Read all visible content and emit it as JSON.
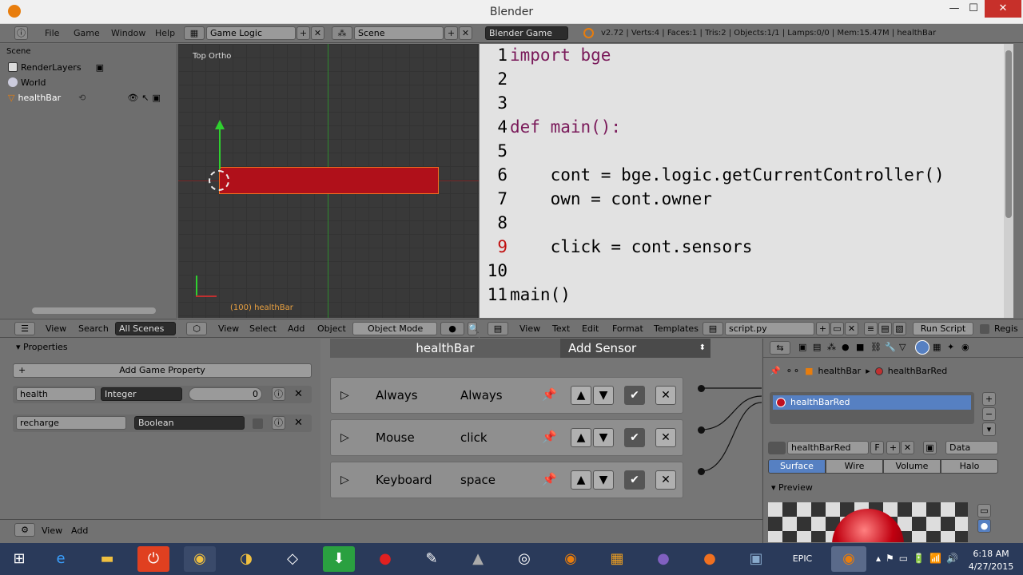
{
  "window": {
    "title": "Blender",
    "minimize": "—",
    "maximize": "☐",
    "close": "✕"
  },
  "menu": {
    "file": "File",
    "game": "Game",
    "window": "Window",
    "help": "Help"
  },
  "screen_layout": "Game Logic",
  "scene_name": "Scene",
  "engine": "Blender Game",
  "stats": "v2.72 | Verts:4 | Faces:1 | Tris:2 | Objects:1/1 | Lamps:0/0 | Mem:15.47M | healthBar",
  "outliner": {
    "header": "Scene",
    "items": [
      "RenderLayers",
      "World",
      "healthBar"
    ]
  },
  "viewport": {
    "label": "Top Ortho",
    "object_label": "(100) healthBar",
    "bar_color": "#b0101a"
  },
  "code": {
    "lines": [
      {
        "n": "1",
        "t": "import bge"
      },
      {
        "n": "2",
        "t": ""
      },
      {
        "n": "3",
        "t": ""
      },
      {
        "n": "4",
        "t": "def main():"
      },
      {
        "n": "5",
        "t": ""
      },
      {
        "n": "6",
        "t": "    cont = bge.logic.getCurrentController()"
      },
      {
        "n": "7",
        "t": "    own = cont.owner"
      },
      {
        "n": "8",
        "t": ""
      },
      {
        "n": "9",
        "t": "    click = cont.sensors"
      },
      {
        "n": "10",
        "t": ""
      },
      {
        "n": "11",
        "t": "main()"
      }
    ]
  },
  "outliner_header": {
    "view": "View",
    "search": "Search",
    "filter": "All Scenes"
  },
  "view3d_header": {
    "view": "View",
    "select": "Select",
    "add": "Add",
    "object": "Object",
    "mode": "Object Mode"
  },
  "text_header": {
    "view": "View",
    "text": "Text",
    "edit": "Edit",
    "format": "Format",
    "templates": "Templates",
    "filename": "script.py",
    "run": "Run Script",
    "register": "Regis"
  },
  "properties": {
    "title": "Properties",
    "add": "Add Game Property",
    "rows": [
      {
        "name": "health",
        "type": "Integer",
        "value": "0"
      },
      {
        "name": "recharge",
        "type": "Boolean",
        "value": ""
      }
    ]
  },
  "logic": {
    "object": "healthBar",
    "add_sensor": "Add Sensor",
    "sensors": [
      {
        "type": "Always",
        "name": "Always"
      },
      {
        "type": "Mouse",
        "name": "click"
      },
      {
        "type": "Keyboard",
        "name": "space"
      }
    ]
  },
  "material": {
    "crumb_object": "healthBar",
    "crumb_material": "healthBarRed",
    "slot": "healthBarRed",
    "datablock": "healthBarRed",
    "fake": "F",
    "link": "Data",
    "tabs": [
      "Surface",
      "Wire",
      "Volume",
      "Halo"
    ],
    "preview": "Preview",
    "accent": "#5680c2"
  },
  "bottom": {
    "view": "View",
    "add": "Add"
  },
  "clock": {
    "time": "6:18 AM",
    "date": "4/27/2015"
  }
}
